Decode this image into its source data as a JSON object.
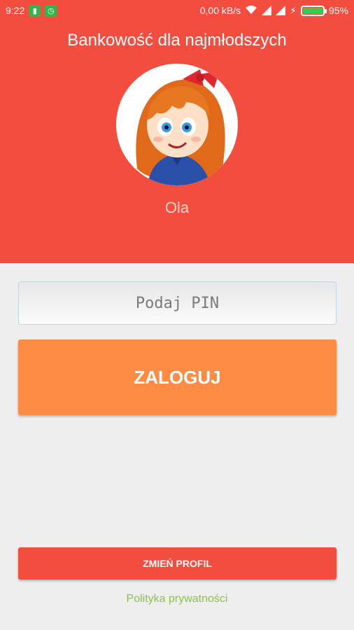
{
  "status_bar": {
    "time": "9:22",
    "speed": "0,00 kB/s",
    "battery_percent": "95%",
    "battery_level": 0.95,
    "icons": [
      "sim-icon",
      "clock-icon",
      "wifi-icon",
      "signal-icon",
      "signal-icon",
      "charging-icon",
      "battery-icon"
    ]
  },
  "header": {
    "title": "Bankowość dla najmłodszych",
    "profile_name": "Ola",
    "background_color": "#f34d3f"
  },
  "login": {
    "pin_placeholder": "Podaj PIN",
    "login_label": "ZALOGUJ",
    "accent_color": "#ff8c44"
  },
  "footer": {
    "change_profile_label": "ZMIEŃ PROFIL",
    "privacy_label": "Polityka prywatności",
    "link_color": "#8bc34a"
  }
}
